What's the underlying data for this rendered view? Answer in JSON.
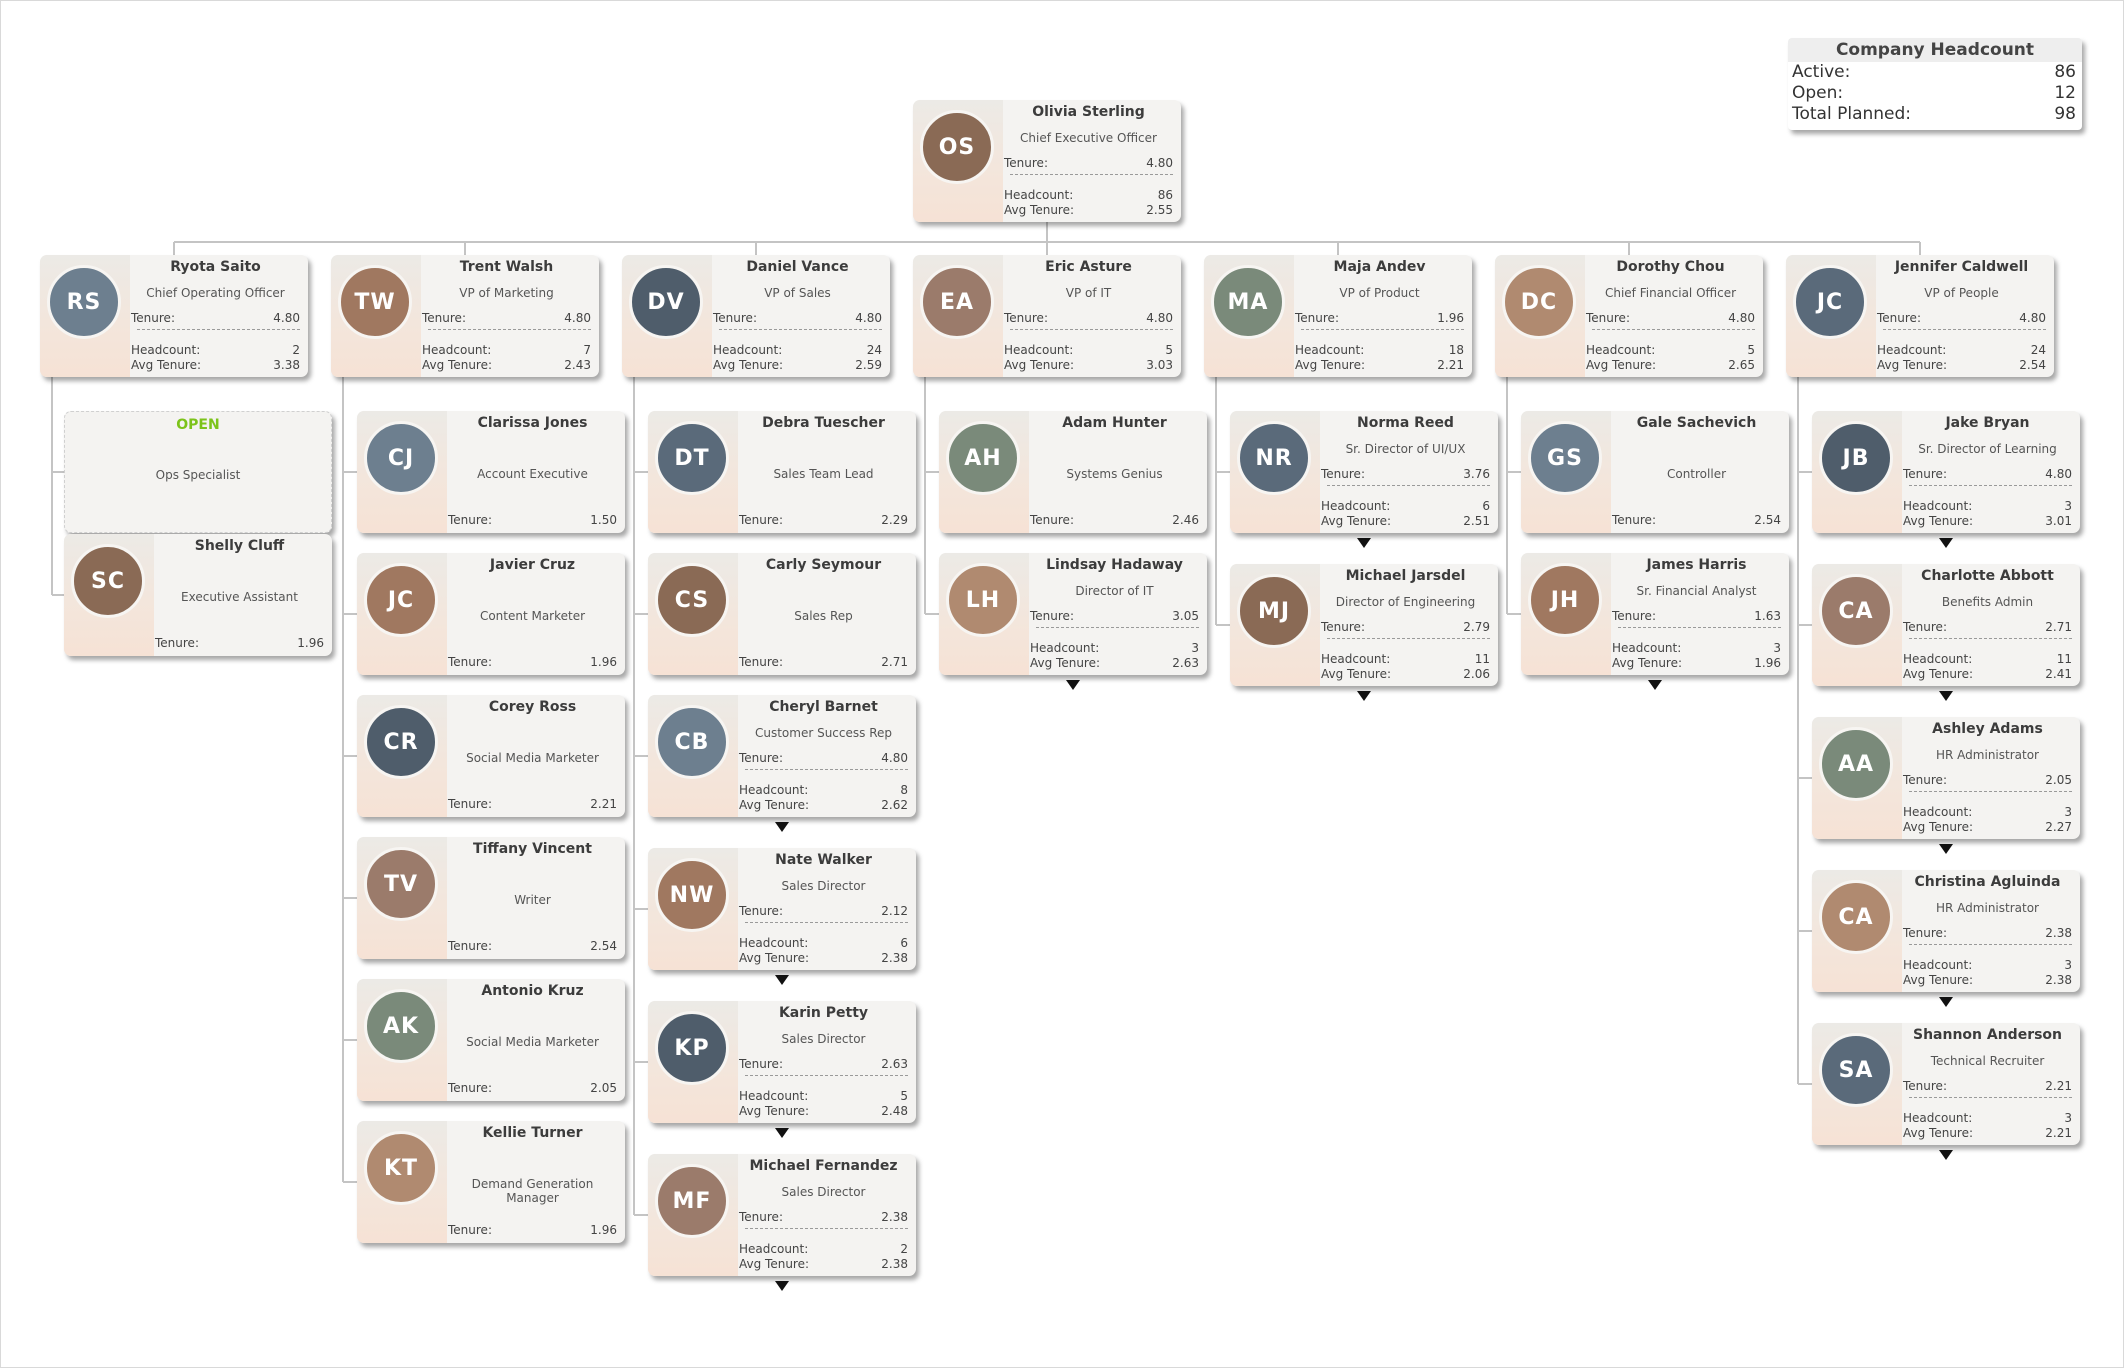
{
  "summary": {
    "title": "Company Headcount",
    "rows": [
      {
        "label": "Active:",
        "value": "86"
      },
      {
        "label": "Open:",
        "value": "12"
      },
      {
        "label": "Total Planned:",
        "value": "98"
      }
    ]
  },
  "labels": {
    "tenure": "Tenure:",
    "headcount": "Headcount:",
    "avg_tenure": "Avg Tenure:",
    "open": "OPEN"
  },
  "colors": {
    "open_accent": "#7cc31a",
    "card_bg": "#f4f3f1",
    "photo_column": "#f6e2d5",
    "connector": "#c4c4c4"
  },
  "ceo": {
    "name": "Olivia Sterling",
    "title": "Chief Executive Officer",
    "tenure": "4.80",
    "headcount": "86",
    "avg_tenure": "2.55",
    "initials": "OS"
  },
  "executives": [
    {
      "name": "Ryota Saito",
      "title": "Chief Operating Officer",
      "tenure": "4.80",
      "headcount": "2",
      "avg_tenure": "3.38",
      "initials": "RS"
    },
    {
      "name": "Trent Walsh",
      "title": "VP of Marketing",
      "tenure": "4.80",
      "headcount": "7",
      "avg_tenure": "2.43",
      "initials": "TW"
    },
    {
      "name": "Daniel Vance",
      "title": "VP of Sales",
      "tenure": "4.80",
      "headcount": "24",
      "avg_tenure": "2.59",
      "initials": "DV"
    },
    {
      "name": "Eric Asture",
      "title": "VP of IT",
      "tenure": "4.80",
      "headcount": "5",
      "avg_tenure": "3.03",
      "initials": "EA"
    },
    {
      "name": "Maja Andev",
      "title": "VP of Product",
      "tenure": "1.96",
      "headcount": "18",
      "avg_tenure": "2.21",
      "initials": "MA"
    },
    {
      "name": "Dorothy Chou",
      "title": "Chief Financial Officer",
      "tenure": "4.80",
      "headcount": "5",
      "avg_tenure": "2.65",
      "initials": "DC"
    },
    {
      "name": "Jennifer Caldwell",
      "title": "VP of People",
      "tenure": "4.80",
      "headcount": "24",
      "avg_tenure": "2.54",
      "initials": "JC"
    }
  ],
  "reports": {
    "ops": [
      {
        "open": true,
        "title": "Ops Specialist"
      },
      {
        "name": "Shelly Cluff",
        "title": "Executive Assistant",
        "tenure": "1.96",
        "initials": "SC"
      }
    ],
    "marketing": [
      {
        "name": "Clarissa Jones",
        "title": "Account Executive",
        "tenure": "1.50",
        "initials": "CJ"
      },
      {
        "name": "Javier Cruz",
        "title": "Content Marketer",
        "tenure": "1.96",
        "initials": "JC"
      },
      {
        "name": "Corey Ross",
        "title": "Social Media Marketer",
        "tenure": "2.21",
        "initials": "CR"
      },
      {
        "name": "Tiffany Vincent",
        "title": "Writer",
        "tenure": "2.54",
        "initials": "TV"
      },
      {
        "name": "Antonio Kruz",
        "title": "Social Media Marketer",
        "tenure": "2.05",
        "initials": "AK"
      },
      {
        "name": "Kellie Turner",
        "title": "Demand Generation Manager",
        "tenure": "1.96",
        "initials": "KT"
      }
    ],
    "sales": [
      {
        "name": "Debra Tuescher",
        "title": "Sales Team Lead",
        "tenure": "2.29",
        "initials": "DT"
      },
      {
        "name": "Carly Seymour",
        "title": "Sales Rep",
        "tenure": "2.71",
        "initials": "CS"
      },
      {
        "name": "Cheryl Barnet",
        "title": "Customer Success Rep",
        "tenure": "4.80",
        "headcount": "8",
        "avg_tenure": "2.62",
        "initials": "CB"
      },
      {
        "name": "Nate Walker",
        "title": "Sales Director",
        "tenure": "2.12",
        "headcount": "6",
        "avg_tenure": "2.38",
        "initials": "NW"
      },
      {
        "name": "Karin Petty",
        "title": "Sales Director",
        "tenure": "2.63",
        "headcount": "5",
        "avg_tenure": "2.48",
        "initials": "KP"
      },
      {
        "name": "Michael Fernandez",
        "title": "Sales Director",
        "tenure": "2.38",
        "headcount": "2",
        "avg_tenure": "2.38",
        "initials": "MF"
      }
    ],
    "it": [
      {
        "name": "Adam Hunter",
        "title": "Systems Genius",
        "tenure": "2.46",
        "initials": "AH"
      },
      {
        "name": "Lindsay Hadaway",
        "title": "Director of IT",
        "tenure": "3.05",
        "headcount": "3",
        "avg_tenure": "2.63",
        "initials": "LH"
      }
    ],
    "product": [
      {
        "name": "Norma Reed",
        "title": "Sr. Director of UI/UX",
        "tenure": "3.76",
        "headcount": "6",
        "avg_tenure": "2.51",
        "initials": "NR"
      },
      {
        "name": "Michael Jarsdel",
        "title": "Director of Engineering",
        "tenure": "2.79",
        "headcount": "11",
        "avg_tenure": "2.06",
        "initials": "MJ"
      }
    ],
    "finance": [
      {
        "name": "Gale Sachevich",
        "title": "Controller",
        "tenure": "2.54",
        "initials": "GS"
      },
      {
        "name": "James Harris",
        "title": "Sr. Financial Analyst",
        "tenure": "1.63",
        "headcount": "3",
        "avg_tenure": "1.96",
        "initials": "JH"
      }
    ],
    "people": [
      {
        "name": "Jake Bryan",
        "title": "Sr. Director of Learning",
        "tenure": "4.80",
        "headcount": "3",
        "avg_tenure": "3.01",
        "initials": "JB"
      },
      {
        "name": "Charlotte Abbott",
        "title": "Benefits Admin",
        "tenure": "2.71",
        "headcount": "11",
        "avg_tenure": "2.41",
        "initials": "CA"
      },
      {
        "name": "Ashley Adams",
        "title": "HR Administrator",
        "tenure": "2.05",
        "headcount": "3",
        "avg_tenure": "2.27",
        "initials": "AA"
      },
      {
        "name": "Christina Agluinda",
        "title": "HR Administrator",
        "tenure": "2.38",
        "headcount": "3",
        "avg_tenure": "2.38",
        "initials": "CA"
      },
      {
        "name": "Shannon Anderson",
        "title": "Technical Recruiter",
        "tenure": "2.21",
        "headcount": "3",
        "avg_tenure": "2.21",
        "initials": "SA"
      }
    ]
  }
}
